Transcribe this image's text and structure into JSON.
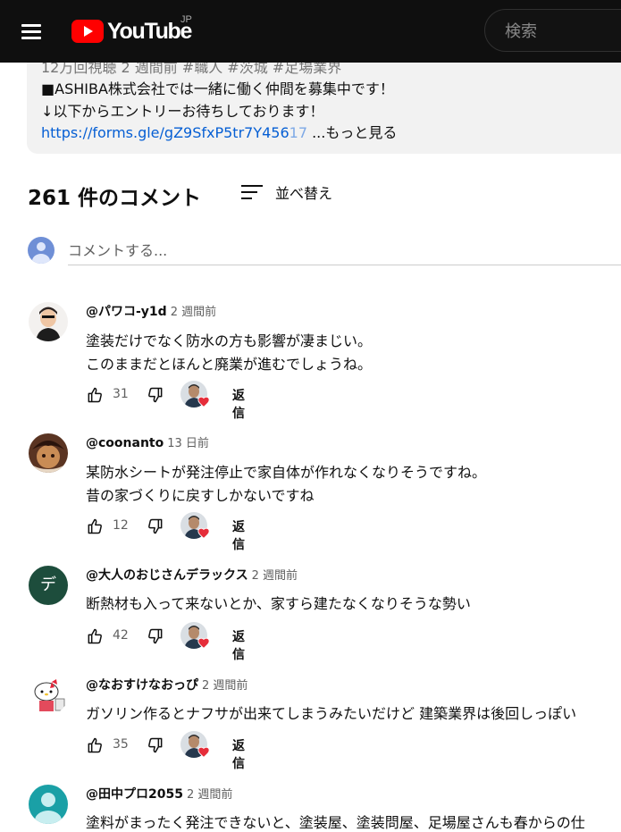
{
  "header": {
    "logo_text": "YouTube",
    "region": "JP",
    "search_placeholder": "検索"
  },
  "description": {
    "cut_line": "12万回視聴  2 週間前  #職人 #茨城 #足場業界",
    "line1": "■ASHIBA株式会社では一緒に働く仲間を募集中です！",
    "line2": "↓以下からエントリーお待ちしております！",
    "link_main": "https://forms.gle/gZ9SfxP5tr7Y456",
    "link_fade": "17",
    "more": "...もっと見る"
  },
  "comments_header": {
    "count": "261 件のコメント",
    "sort_label": "並べ替え",
    "add_placeholder": "コメントする..."
  },
  "comments": [
    {
      "author": "@パワコ-y1d",
      "time": "2 週間前",
      "lines": [
        "塗装だけでなく防水の方も影響が凄まじい。",
        "このままだとほんと廃業が進むでしょうね。"
      ],
      "likes": "31",
      "reply": "返信"
    },
    {
      "author": "@coonanto",
      "time": "13 日前",
      "lines": [
        "某防水シートが発注停止で家自体が作れなくなりそうですね。",
        "昔の家づくりに戻すしかないですね"
      ],
      "likes": "12",
      "reply": "返信"
    },
    {
      "author": "@大人のおじさんデラックス",
      "time": "2 週間前",
      "avatar_letter": "デ",
      "lines": [
        "断熱材も入って来ないとか、家すら建たなくなりそうな勢い"
      ],
      "likes": "42",
      "reply": "返信"
    },
    {
      "author": "@なおすけなおっぴ",
      "time": "2 週間前",
      "lines": [
        "ガソリン作るとナフサが出来てしまうみたいだけど 建築業界は後回しっぽい"
      ],
      "likes": "35",
      "reply": "返信"
    },
    {
      "author": "@田中プロ2055",
      "time": "2 週間前",
      "lines": [
        "塗料がまったく発注できないと、塗装屋、塗装問屋、足場屋さんも春からの仕"
      ]
    }
  ],
  "colors": {
    "header_bg": "#0f0f0f",
    "brand_red": "#ff0000",
    "link": "#065fd4",
    "heart": "#e52d3a",
    "avatar_green": "#1d4d3c",
    "avatar_teal": "#1aa0a6"
  }
}
